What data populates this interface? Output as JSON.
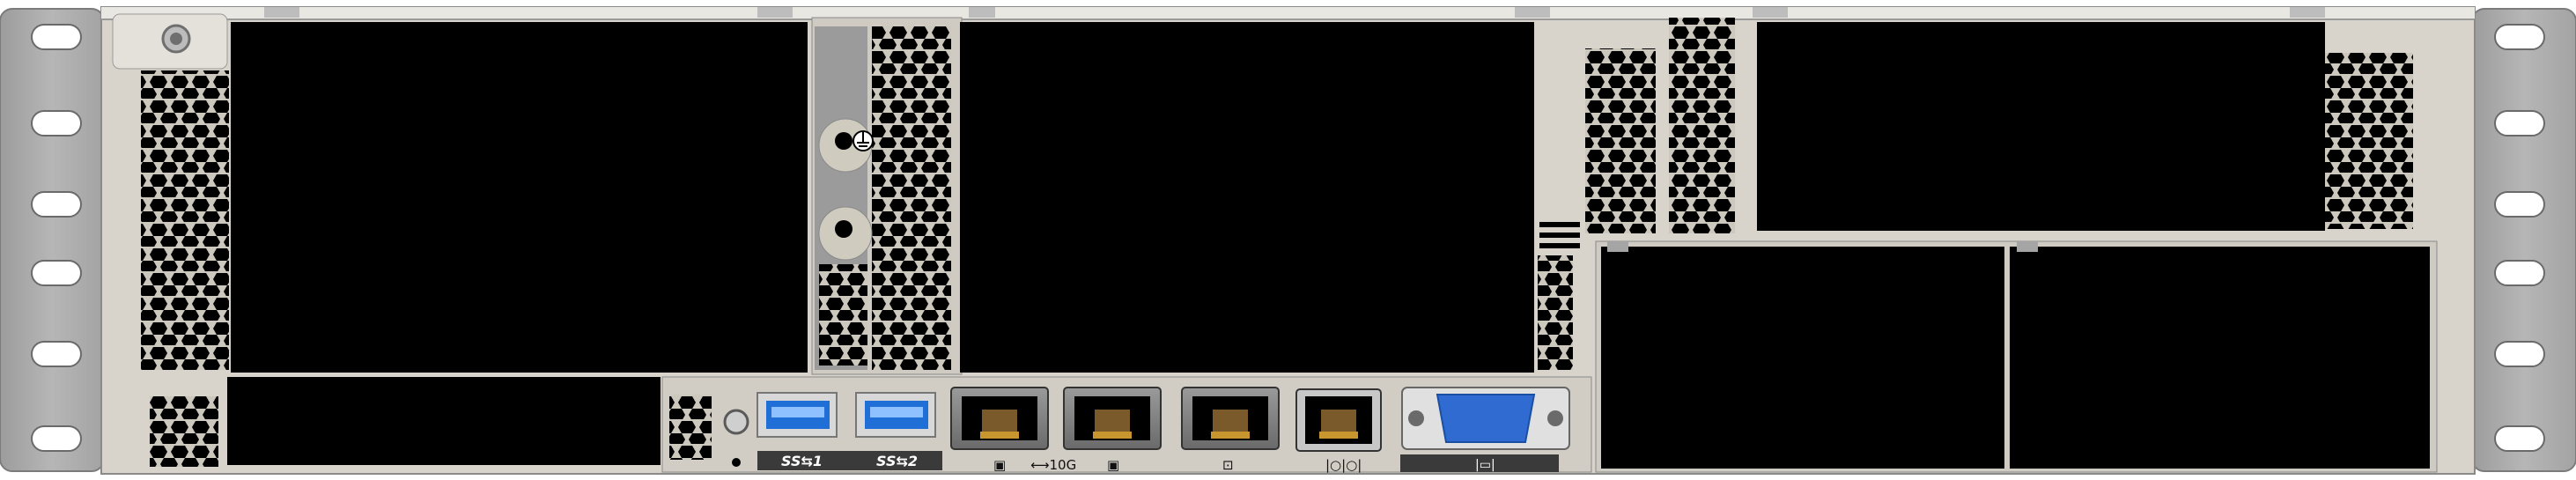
{
  "chassis": {
    "name": "2U server rear panel",
    "colors": {
      "ear": "#a9a9a9",
      "body": "#d9d6cf",
      "bay": "#000000",
      "usb_blue": "#1f6fd6",
      "vga_blue": "#2f6bd1",
      "label_bar": "#3a3a3a"
    }
  },
  "io": {
    "usb1": {
      "icon": "usb-icon",
      "text": "SS⇆1"
    },
    "usb2": {
      "icon": "usb-icon",
      "text": "SS⇆2"
    },
    "nic1": {
      "icon": "network-icon"
    },
    "nic2": {
      "icon": "network-icon"
    },
    "speed_label": "⟷10G",
    "mgmt": {
      "icon": "management-icon"
    },
    "serial": {
      "icon": "serial-port-icon"
    },
    "vga": {
      "icon": "vga-icon"
    },
    "uid": {
      "icon": "uid-button-icon"
    },
    "ground": {
      "icon": "ground-icon"
    }
  }
}
